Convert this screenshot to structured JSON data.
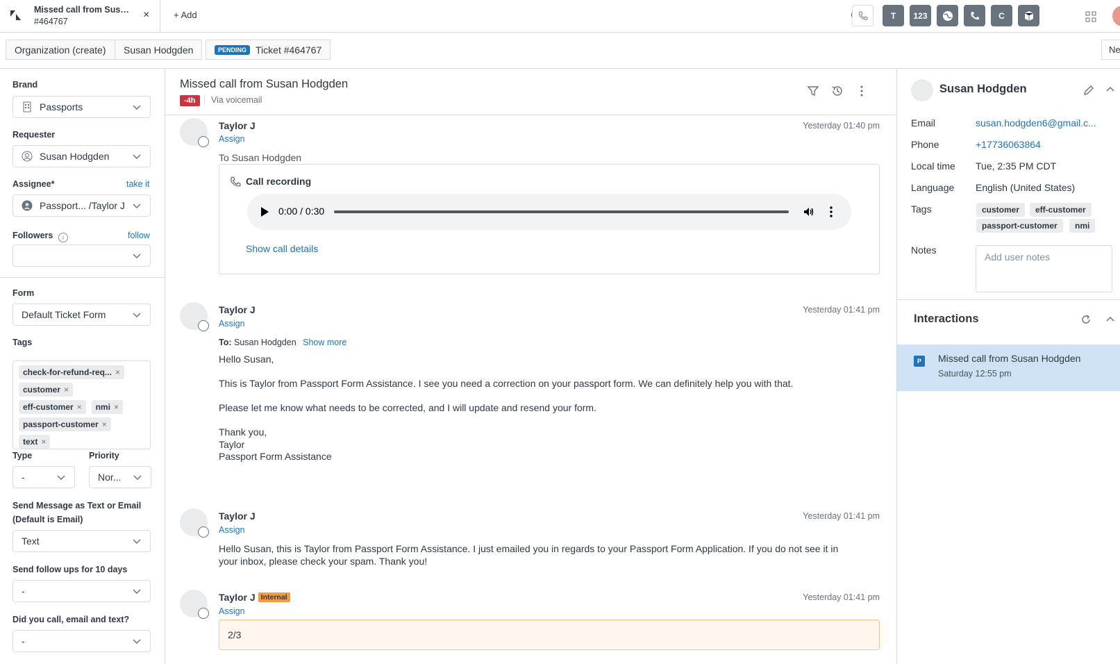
{
  "tab": {
    "title": "Missed call from Susan Hodgden",
    "title_display": "Missed call from Susa...",
    "subtitle": "#464767",
    "add_label": "Add"
  },
  "toolbar": {
    "apps": [
      "phone-outline",
      "T",
      "123",
      "globe",
      "phone",
      "C",
      "box"
    ],
    "apps_text": {
      "t": "T",
      "num": "123",
      "c": "C"
    }
  },
  "breadcrumbs": {
    "org": "Organization (create)",
    "user": "Susan Hodgden",
    "status_badge": "PENDING",
    "ticket": "Ticket #464767",
    "next": "Ne"
  },
  "left": {
    "brand_label": "Brand",
    "brand_value": "Passports",
    "requester_label": "Requester",
    "requester_value": "Susan Hodgden",
    "assignee_label": "Assignee*",
    "take_it": "take it",
    "assignee_value": "Passport... /Taylor J",
    "followers_label": "Followers",
    "follow": "follow",
    "form_label": "Form",
    "form_value": "Default Ticket Form",
    "tags_label": "Tags",
    "tags": [
      "check-for-refund-req...",
      "customer",
      "eff-customer",
      "nmi",
      "passport-customer",
      "text"
    ],
    "type_label": "Type",
    "type_value": "-",
    "priority_label": "Priority",
    "priority_value": "Nor...",
    "send_msg_label_1": "Send Message as Text or Email",
    "send_msg_label_2": "(Default is Email)",
    "send_msg_value": "Text",
    "followups_label": "Send follow ups for 10 days",
    "followups_value": "-",
    "called_label": "Did you call, email and text?",
    "called_value": "-"
  },
  "header": {
    "title": "Missed call from Susan Hodgden",
    "sla": "-4h",
    "via": "Via voicemail"
  },
  "messages": [
    {
      "author": "Taylor J",
      "assign": "Assign",
      "time": "Yesterday 01:40 pm",
      "to": "To Susan Hodgden",
      "recording_title": "Call recording",
      "audio_time": "0:00 / 0:30",
      "show_details": "Show call details"
    },
    {
      "author": "Taylor J",
      "assign": "Assign",
      "time": "Yesterday 01:41 pm",
      "to_label": "To:",
      "to_name": "Susan Hodgden",
      "show_more": "Show more",
      "lines": [
        "Hello Susan,",
        "This is Taylor from Passport Form Assistance. I see you need a correction on your passport form. We can definitely help you with that.",
        "Please let me know what needs to be corrected, and I will update and resend your form.",
        "Thank you,",
        "Taylor",
        "Passport Form Assistance"
      ]
    },
    {
      "author": "Taylor J",
      "assign": "Assign",
      "time": "Yesterday 01:41 pm",
      "line1": "Hello Susan, this is Taylor from Passport Form Assistance. I just emailed you in regards to your Passport Form Application. If you do not see it in",
      "line2": "your inbox, please check your spam. Thank you!"
    },
    {
      "author": "Taylor J",
      "badge": "Internal",
      "assign": "Assign",
      "time": "Yesterday 01:41 pm",
      "note": "2/3"
    }
  ],
  "user": {
    "name": "Susan Hodgden",
    "email_label": "Email",
    "email": "susan.hodgden6@gmail.c...",
    "phone_label": "Phone",
    "phone": "+17736063864",
    "local_label": "Local time",
    "local": "Tue, 2:35 PM CDT",
    "language_label": "Language",
    "language": "English (United States)",
    "tags_label": "Tags",
    "tags": [
      "customer",
      "eff-customer",
      "passport-customer",
      "nmi"
    ],
    "notes_label": "Notes",
    "notes_placeholder": "Add user notes"
  },
  "interactions": {
    "title": "Interactions",
    "item_icon": "P",
    "item_title": "Missed call from Susan Hodgden",
    "item_time": "Saturday 12:55 pm"
  }
}
